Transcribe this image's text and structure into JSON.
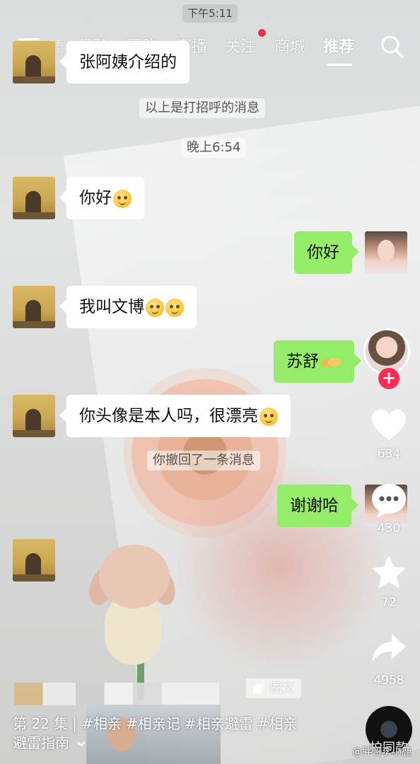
{
  "status_bar": {
    "time": "下午5:11"
  },
  "top_nav": {
    "tabs": [
      {
        "label": "鹿"
      },
      {
        "label": "经验"
      },
      {
        "label": "团购"
      },
      {
        "label": "直播"
      },
      {
        "label": "关注"
      },
      {
        "label": "商城"
      },
      {
        "label": "推荐",
        "active": true
      }
    ]
  },
  "chat": {
    "messages": [
      {
        "from": "left",
        "text": "张阿姨介绍的"
      },
      {
        "system": "以上是打招呼的消息"
      },
      {
        "time": "晚上6:54"
      },
      {
        "from": "left",
        "text": "你好"
      },
      {
        "from": "right",
        "text": "你好"
      },
      {
        "from": "left",
        "text": "我叫文博"
      },
      {
        "from": "right",
        "text": "苏舒"
      },
      {
        "from": "left",
        "text": "你头像是本人吗，很漂亮"
      },
      {
        "system": "你撤回了一条消息"
      },
      {
        "from": "right",
        "text": "谢谢哈"
      }
    ]
  },
  "right_rail": {
    "likes": "634",
    "comments": "430",
    "favorites": "72",
    "shares": "4958",
    "music_label": "拍同款"
  },
  "bottom": {
    "album_tag": "图文",
    "caption": {
      "episode": "第 22 集",
      "tags": [
        "#相亲",
        "#相亲记",
        "#相亲避雷",
        "#相亲"
      ],
      "second_line": "避雷指南"
    },
    "watermark": "@胖哥李小鹿"
  },
  "colors": {
    "bubble_mine": "#95ec69",
    "bubble_theirs": "#ffffff",
    "follow_plus": "#fe2c55",
    "live_dot": "#f0304c"
  }
}
